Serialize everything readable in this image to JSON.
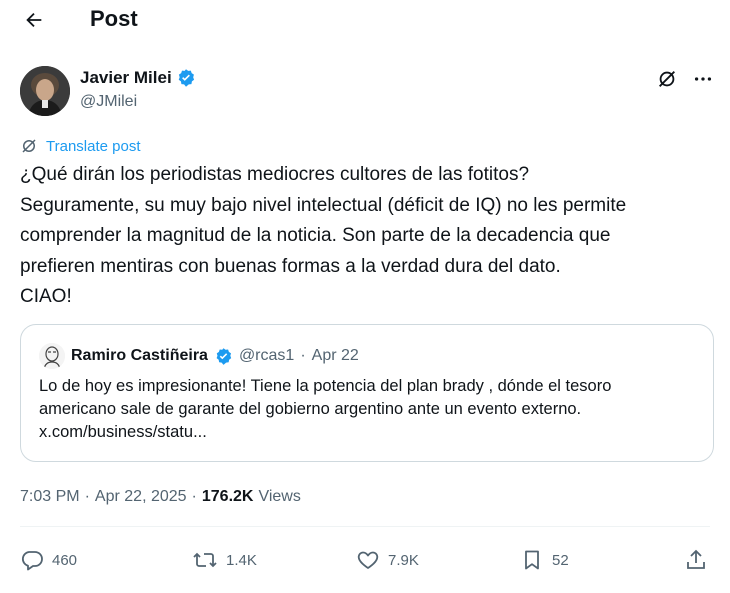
{
  "header": {
    "title": "Post",
    "back_icon": "arrow-left-icon"
  },
  "author": {
    "name": "Javier Milei",
    "handle": "@JMilei",
    "verified": true
  },
  "translate_label": "Translate post",
  "post_text": "¿Qué dirán los periodistas mediocres cultores de las fotitos?\nSeguramente, su muy bajo nivel intelectual (déficit de IQ) no les permite\ncomprender la magnitud de la noticia. Son parte de la decadencia que\nprefieren mentiras con buenas formas a la verdad dura del dato.\nCIAO!",
  "quote": {
    "name": "Ramiro Castiñeira",
    "handle": "@rcas1",
    "separator": "·",
    "date": "Apr 22",
    "verified": true,
    "text": "Lo de hoy es impresionante! Tiene la potencia del plan brady , dónde el tesoro\namericano sale de garante del gobierno argentino ante un evento externo.\nx.com/business/statu..."
  },
  "meta": {
    "time": "7:03 PM",
    "sep1": "·",
    "date": "Apr 22, 2025",
    "sep2": "·",
    "views_count": "176.2K",
    "views_label": "Views"
  },
  "actions": {
    "replies": "460",
    "reposts": "1.4K",
    "likes": "7.9K",
    "bookmarks": "52"
  },
  "colors": {
    "accent": "#1d9bf0",
    "secondary_text": "#536471",
    "border": "#cfd9de"
  }
}
